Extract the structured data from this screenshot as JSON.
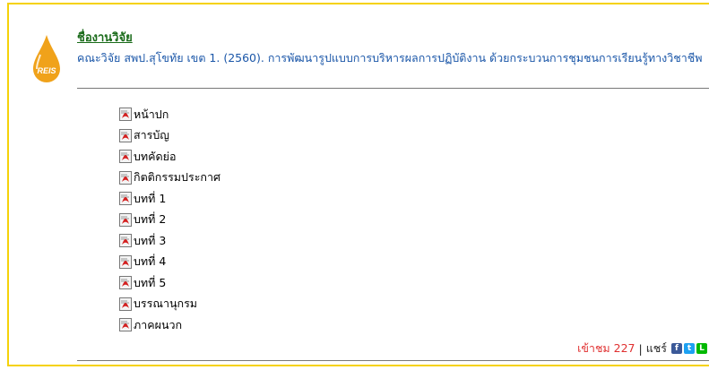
{
  "research": {
    "heading": "ชื่องานวิจัย",
    "citation": "คณะวิจัย สพป.สุโขทัย เขต 1. (2560). การพัฒนารูปแบบการบริหารผลการปฏิบัติงาน ด้วยกระบวนการชุมชนการเรียนรู้ทางวิชาชีพ",
    "logo_text": "REIS"
  },
  "files": [
    {
      "label": "หน้าปก",
      "icon": "pdf-icon"
    },
    {
      "label": "สารบัญ",
      "icon": "pdf-icon"
    },
    {
      "label": "บทคัดย่อ",
      "icon": "pdf-icon"
    },
    {
      "label": "กิตติกรรมประกาศ",
      "icon": "pdf-icon"
    },
    {
      "label": "บทที่ 1",
      "icon": "pdf-icon"
    },
    {
      "label": "บทที่ 2",
      "icon": "pdf-icon"
    },
    {
      "label": "บทที่ 3",
      "icon": "pdf-icon"
    },
    {
      "label": "บทที่ 4",
      "icon": "pdf-icon"
    },
    {
      "label": "บทที่ 5",
      "icon": "pdf-icon"
    },
    {
      "label": "บรรณานุกรม",
      "icon": "pdf-icon"
    },
    {
      "label": "ภาคผนวก",
      "icon": "pdf-icon"
    }
  ],
  "footer": {
    "views": "เข้าชม 227",
    "separator": "|",
    "share_label": "แชร์",
    "share_icons": [
      "facebook-icon",
      "twitter-icon",
      "line-icon"
    ]
  },
  "colors": {
    "frame_border": "#f5d20a",
    "logo": "#f0a21a",
    "heading": "#1a6b1a",
    "citation": "#1a56a8",
    "views": "#e03030",
    "facebook": "#3b5998",
    "twitter": "#1da1f2",
    "line": "#00b900"
  }
}
